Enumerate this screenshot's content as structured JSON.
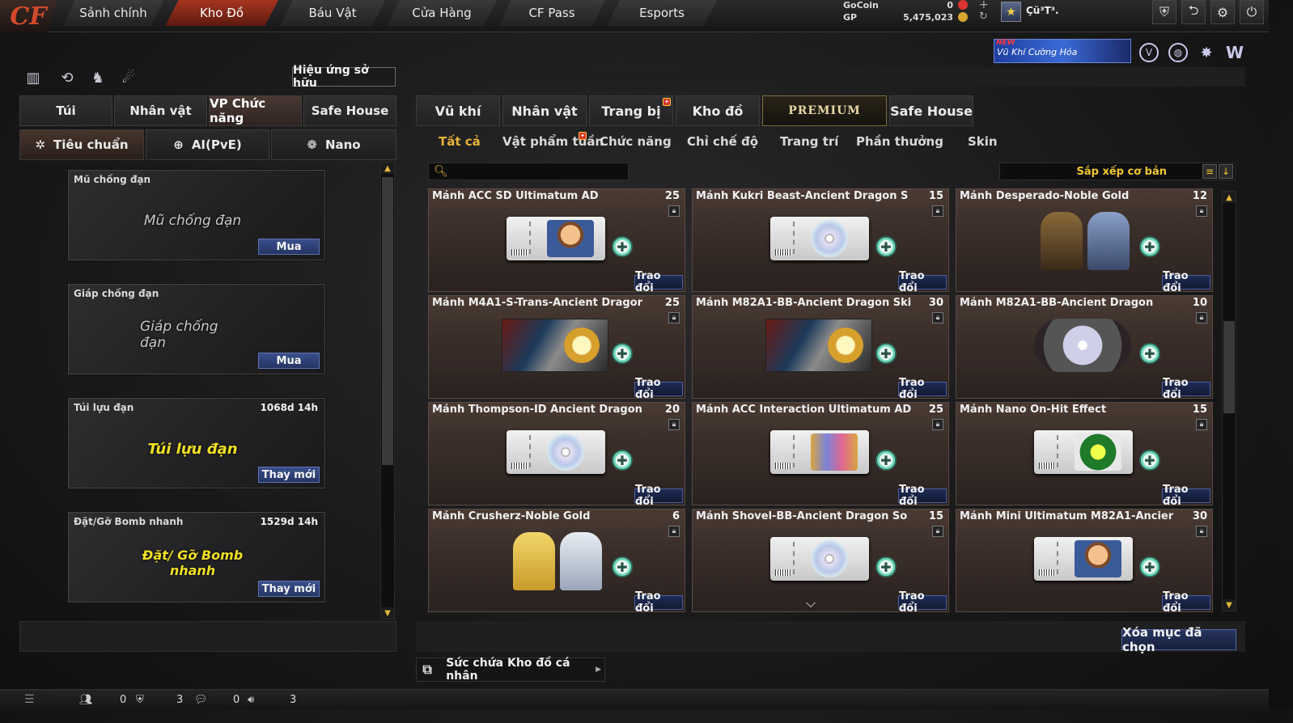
{
  "nav": {
    "tabs": [
      "Sảnh chính",
      "Kho Đồ",
      "Báu Vật",
      "Cửa Hàng",
      "CF Pass",
      "Esports"
    ],
    "active_index": 1
  },
  "currency": {
    "gocoin_label": "GoCoin",
    "gocoin_value": "0",
    "gp_label": "GP",
    "gp_value": "5,475,023"
  },
  "player": {
    "name": "Çü³T³."
  },
  "promo": {
    "new_label": "NEW",
    "title": "Vũ Khí Cường Hóa"
  },
  "left_panel": {
    "effect_button": "Hiệu ứng sở hữu",
    "tabs": [
      "Túi",
      "Nhân vật",
      "VP Chức năng",
      "Safe House"
    ],
    "active_tab": 2,
    "subtabs": [
      "Tiêu chuẩn",
      "AI(PvE)",
      "Nano"
    ],
    "active_subtab": 0,
    "items": [
      {
        "name": "Mũ chống đạn",
        "duration": "",
        "art_text": "Mũ chống đạn",
        "button": "Mua"
      },
      {
        "name": "Giáp chống đạn",
        "duration": "",
        "art_text": "Giáp chống đạn",
        "button": "Mua"
      },
      {
        "name": "Túi lựu đạn",
        "duration": "1068d 14h",
        "art_text": "Túi lựu đạn",
        "button": "Thay mới"
      },
      {
        "name": "Đặt/Gỡ Bomb nhanh",
        "duration": "1529d 14h",
        "art_text": "Đặt/ Gỡ Bomb nhanh",
        "button": "Thay mới"
      }
    ]
  },
  "right_panel": {
    "tabs": [
      "Vũ khí",
      "Nhân vật",
      "Trang bị",
      "Kho đồ",
      "PREMIUM",
      "Safe House"
    ],
    "active_tab": 4,
    "subtabs": [
      "Tất cả",
      "Vật phẩm tuần",
      "Chức năng",
      "Chỉ chế độ",
      "Trang trí",
      "Phần thưởng",
      "Skin"
    ],
    "active_subtab": 0,
    "search_placeholder": "",
    "sort_label": "Sắp xếp cơ bản",
    "trade_label": "Trao đổi",
    "items": [
      {
        "name": "Mảnh ACC SD Ultimatum AD",
        "qty": "25",
        "art": "chibi"
      },
      {
        "name": "Mảnh Kukri Beast-Ancient Dragon S",
        "qty": "15",
        "art": "disc"
      },
      {
        "name": "Mảnh Desperado-Noble Gold",
        "qty": "12",
        "art": "chars-cowboy"
      },
      {
        "name": "Mảnh M4A1-S-Trans-Ancient Dragor",
        "qty": "25",
        "art": "weapon"
      },
      {
        "name": "Mảnh M82A1-BB-Ancient Dragon Ski",
        "qty": "30",
        "art": "weapon"
      },
      {
        "name": "Mảnh M82A1-BB-Ancient Dragon",
        "qty": "10",
        "art": "music"
      },
      {
        "name": "Mảnh Thompson-ID Ancient Dragon",
        "qty": "20",
        "art": "disc"
      },
      {
        "name": "Mảnh ACC Interaction Ultimatum AD",
        "qty": "25",
        "art": "acc"
      },
      {
        "name": "Mảnh Nano On-Hit Effect",
        "qty": "15",
        "art": "onhit"
      },
      {
        "name": "Mảnh Crusherz-Noble Gold",
        "qty": "6",
        "art": "chars-blonde"
      },
      {
        "name": "Mảnh Shovel-BB-Ancient Dragon So",
        "qty": "15",
        "art": "disc"
      },
      {
        "name": "Mảnh Mini Ultimatum M82A1-Ancier",
        "qty": "30",
        "art": "chibi"
      }
    ],
    "delete_button": "Xóa mục đã chọn",
    "capacity_label": "Sức chứa Kho đồ cá nhân"
  },
  "bottom": {
    "count1": "0",
    "count2": "3",
    "count3": "0",
    "count4": "3"
  },
  "colors": {
    "accent": "#e8b23a",
    "active_nav": "#a6351f",
    "trade_button": "#1e2c55"
  }
}
